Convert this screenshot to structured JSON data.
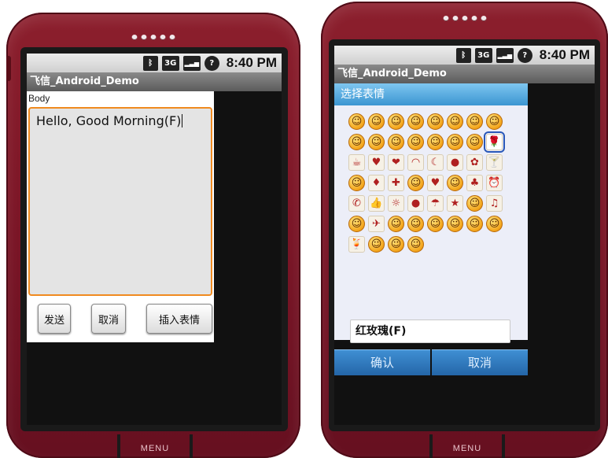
{
  "left_phone": {
    "status_time": "8:40 PM",
    "status_icons": [
      "bluetooth-icon",
      "3g-icon",
      "signal-icon",
      "battery-icon"
    ],
    "status_icon_glyphs": [
      "ᛒ",
      "3G",
      "▂▃▅",
      "?"
    ],
    "app_title": "飞信_Android_Demo",
    "body_label": "Body",
    "body_text": "Hello, Good Morning(F)",
    "buttons": {
      "send": "发送",
      "cancel": "取消",
      "insert_emoticon": "插入表情"
    },
    "menu_label": "MENU"
  },
  "right_phone": {
    "status_time": "8:40 PM",
    "status_icon_glyphs": [
      "ᛒ",
      "3G",
      "▂▃▅",
      "?"
    ],
    "app_title": "飞信_Android_Demo",
    "dialog": {
      "title": "选择表情",
      "emoticons": [
        "☺",
        "☺",
        "☺",
        "☺",
        "☺",
        "☺",
        "☺",
        "☺",
        "☺",
        "☺",
        "☺",
        "☺",
        "☺",
        "☺",
        "☺",
        "🌹",
        "☕",
        "♥",
        "❤",
        "◠",
        "☾",
        "●",
        "✿",
        "🍸",
        "☺",
        "♦",
        "✚",
        "☺",
        "♥",
        "☺",
        "♣",
        "⏰",
        "✆",
        "👍",
        "☼",
        "●",
        "☂",
        "★",
        "☺",
        "♫",
        "☺",
        "✈",
        "☺",
        "☺",
        "☺",
        "☺",
        "☺",
        "☺",
        "🍹",
        "☺",
        "☺",
        "☺"
      ],
      "emoticon_kinds": [
        "face",
        "face",
        "face",
        "face",
        "face",
        "face",
        "face",
        "face",
        "face",
        "face",
        "face",
        "face",
        "face",
        "face",
        "face",
        "sym",
        "sym",
        "sym",
        "sym",
        "sym",
        "sym",
        "sym",
        "sym",
        "sym",
        "face",
        "sym",
        "sym",
        "face",
        "sym",
        "face",
        "sym",
        "sym",
        "sym",
        "sym",
        "sym",
        "sym",
        "sym",
        "sym",
        "face",
        "sym",
        "face",
        "sym",
        "face",
        "face",
        "face",
        "face",
        "face",
        "face",
        "sym",
        "face",
        "face",
        "face"
      ],
      "selected_index": 15,
      "selected_name": "红玫瑰(F)",
      "ok_label": "确认",
      "cancel_label": "取消"
    },
    "menu_label": "MENU"
  },
  "colors": {
    "phone_body": "#7a1526",
    "focus_orange": "#f08a1f",
    "dialog_blue": "#3b95d1"
  }
}
